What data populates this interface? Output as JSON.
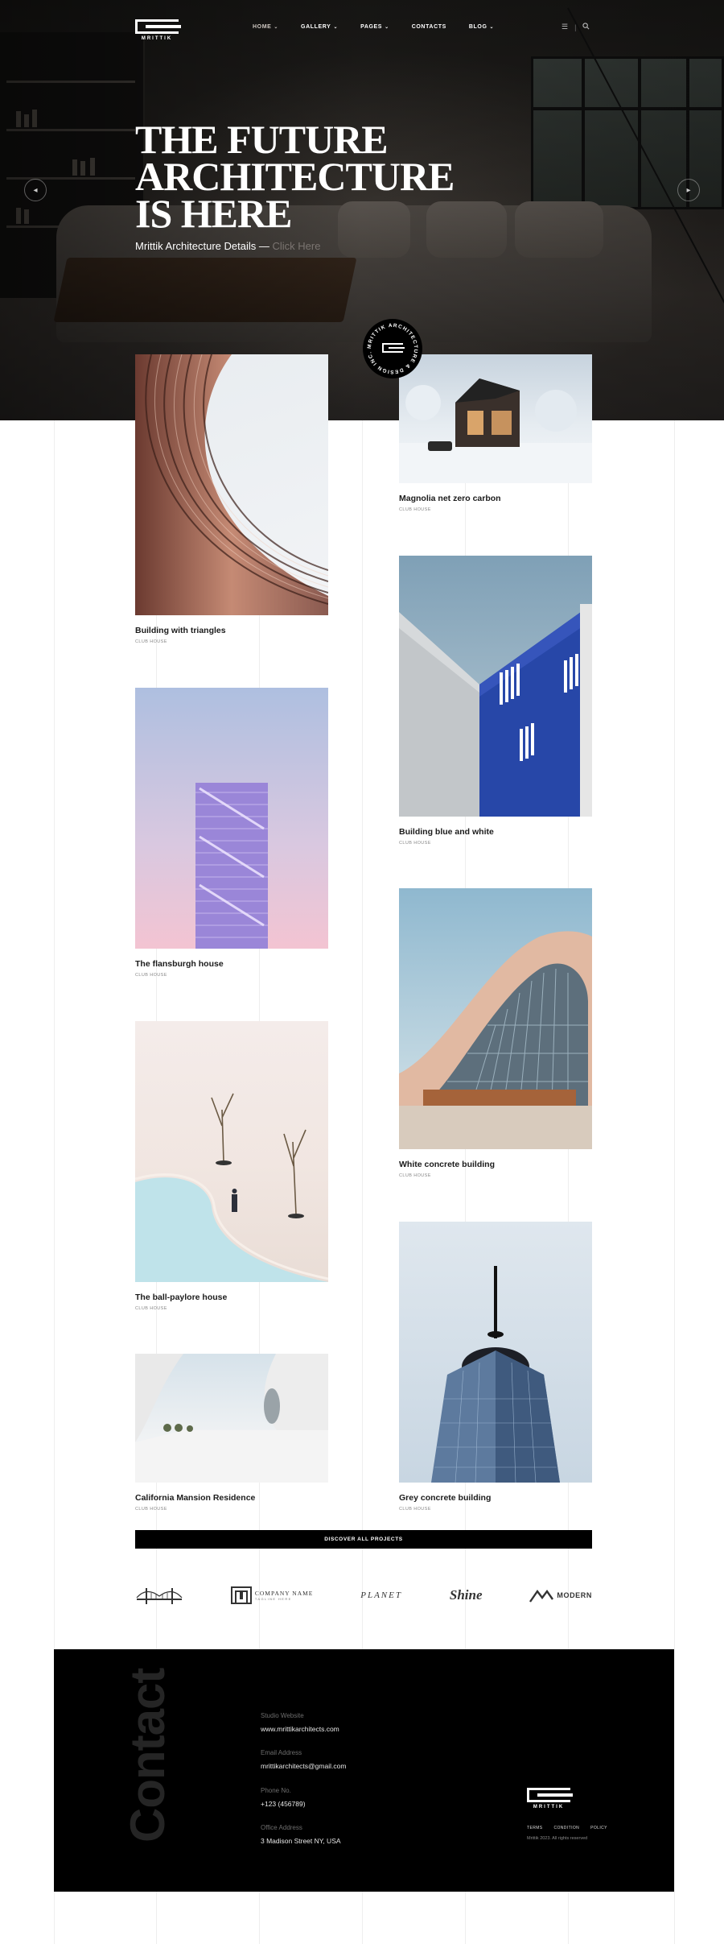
{
  "header": {
    "logo_text": "MRITTIK",
    "nav": [
      {
        "label": "HOME",
        "has_caret": true,
        "active": true
      },
      {
        "label": "GALLERY",
        "has_caret": true,
        "active": false
      },
      {
        "label": "PAGES",
        "has_caret": true,
        "active": false
      },
      {
        "label": "CONTACTS",
        "has_caret": false,
        "active": false
      },
      {
        "label": "BLOG",
        "has_caret": true,
        "active": false
      }
    ],
    "icons": [
      "menu-icon",
      "search-icon"
    ]
  },
  "hero": {
    "title_lines": [
      "THE FUTURE",
      "ARCHITECTURE",
      "IS HERE"
    ],
    "subtitle": "Mrittik Architecture Details —",
    "subtitle_link": "Click Here",
    "prev_arrow": "◂",
    "next_arrow": "▸"
  },
  "badge": {
    "ring_text": "MRITTIK ARCHITECTURE & DESIGN INC."
  },
  "projects": [
    {
      "name": "Building with triangles",
      "category": "CLUB HOUSE"
    },
    {
      "name": "Magnolia net zero carbon",
      "category": "CLUB HOUSE"
    },
    {
      "name": "Building blue and white",
      "category": "CLUB HOUSE"
    },
    {
      "name": "The flansburgh house",
      "category": "CLUB HOUSE"
    },
    {
      "name": "White concrete building",
      "category": "CLUB HOUSE"
    },
    {
      "name": "The ball-paylore house",
      "category": "CLUB HOUSE"
    },
    {
      "name": "California Mansion Residence",
      "category": "CLUB HOUSE"
    },
    {
      "name": "Grey concrete building",
      "category": "CLUB HOUSE"
    }
  ],
  "discover_button": "DISCOVER ALL PROJECTS",
  "brands": [
    {
      "icon": "bridge-logo-icon",
      "text": ""
    },
    {
      "icon": "company-logo-icon",
      "text": "COMPANY NAME",
      "tagline": "TAGLINE HERE"
    },
    {
      "icon": "planet-logo-icon",
      "text": "PLANET"
    },
    {
      "icon": "shine-logo-icon",
      "text": "Shine"
    },
    {
      "icon": "modern-logo-icon",
      "text": "MODERN"
    }
  ],
  "contact": {
    "side_word": "Contact",
    "fields": [
      {
        "label": "Studio Website",
        "value": "www.mrittikarchitects.com"
      },
      {
        "label": "Email Address",
        "value": "mrittikarchitects@gmail.com"
      },
      {
        "label": "Phone No.",
        "value": "+123 (456789)"
      },
      {
        "label": "Office Address",
        "value": "3 Madison Street NY, USA"
      }
    ],
    "logo_text": "MRITTIK",
    "links": [
      "TERMS",
      "CONDITION",
      "POLICY"
    ],
    "copyright": "Mrittik 2023. All rights reserved"
  }
}
